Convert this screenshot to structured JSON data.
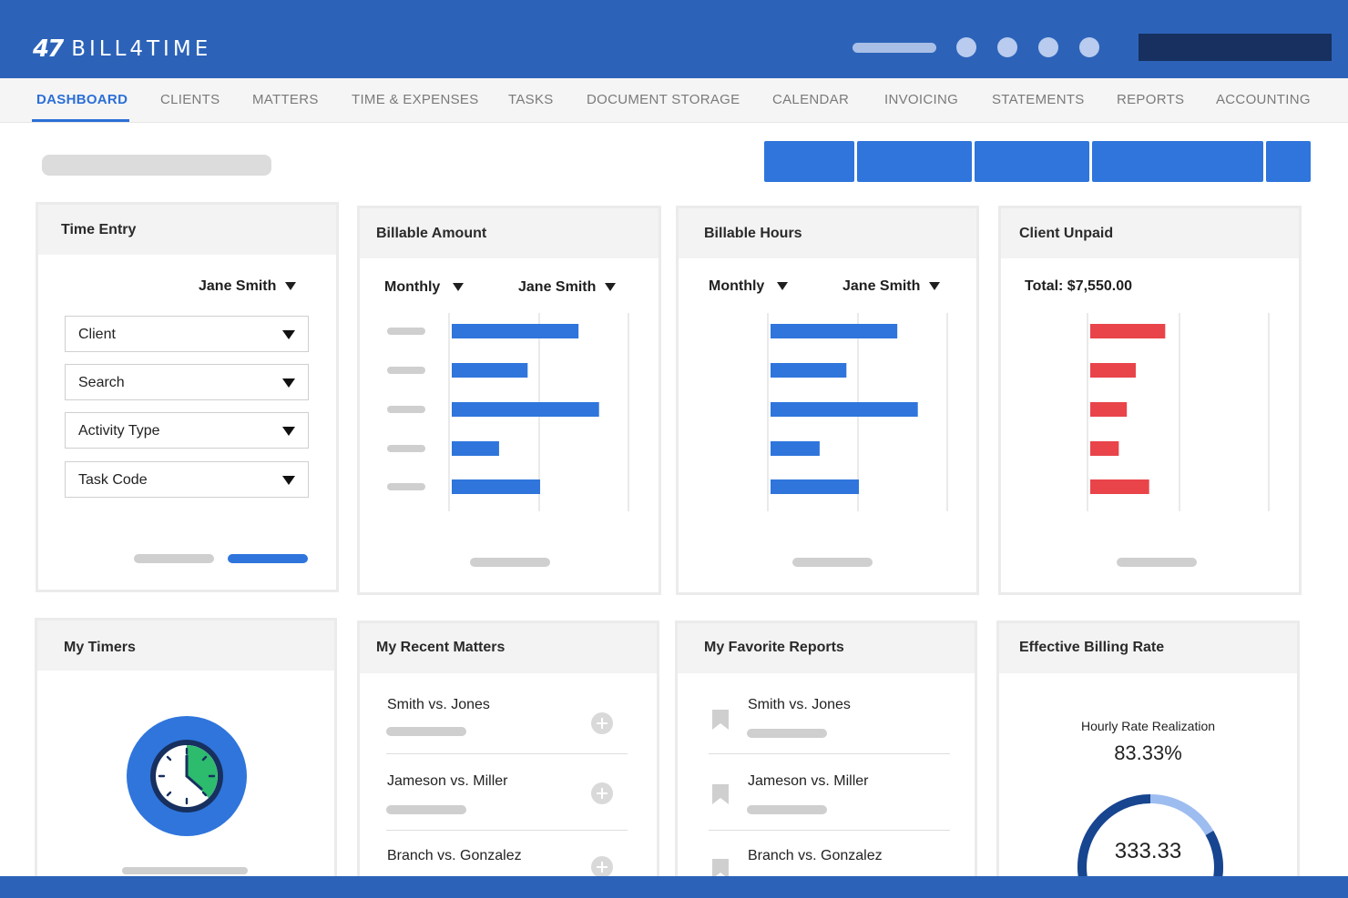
{
  "app": {
    "logo_mark": "47",
    "logo_text": "BILL4TIME"
  },
  "nav": {
    "items": [
      {
        "label": "DASHBOARD",
        "active": true
      },
      {
        "label": "CLIENTS"
      },
      {
        "label": "MATTERS"
      },
      {
        "label": "TIME & EXPENSES"
      },
      {
        "label": "TASKS"
      },
      {
        "label": "DOCUMENT STORAGE"
      },
      {
        "label": "CALENDAR"
      },
      {
        "label": "INVOICING"
      },
      {
        "label": "STATEMENTS"
      },
      {
        "label": "REPORTS"
      },
      {
        "label": "ACCOUNTING"
      }
    ]
  },
  "time_entry": {
    "title": "Time Entry",
    "user": "Jane Smith",
    "fields": [
      "Client",
      "Search",
      "Activity Type",
      "Task Code"
    ]
  },
  "billable_amount": {
    "title": "Billable Amount",
    "period": "Monthly",
    "user": "Jane Smith"
  },
  "billable_hours": {
    "title": "Billable Hours",
    "period": "Monthly",
    "user": "Jane Smith"
  },
  "client_unpaid": {
    "title": "Client Unpaid",
    "total": "Total: $7,550.00"
  },
  "my_timers": {
    "title": "My Timers"
  },
  "recent_matters": {
    "title": "My Recent Matters",
    "items": [
      "Smith vs. Jones",
      "Jameson vs. Miller",
      "Branch vs. Gonzalez"
    ]
  },
  "favorite_reports": {
    "title": "My Favorite Reports",
    "items": [
      "Smith vs. Jones",
      "Jameson vs. Miller",
      "Branch vs. Gonzalez"
    ]
  },
  "billing_rate": {
    "title": "Effective Billing Rate",
    "subtitle": "Hourly Rate Realization",
    "percent": "83.33%",
    "value": "333.33",
    "realization": 0.8333
  },
  "colors": {
    "brand": "#2c63b9",
    "accent": "#2f75dc",
    "unpaid": "#e8444a",
    "timer": "#2dbb6e"
  },
  "chart_data": [
    {
      "type": "bar",
      "title": "Billable Amount",
      "orientation": "horizontal",
      "categories": [
        "",
        "",
        "",
        "",
        ""
      ],
      "values": [
        1.42,
        0.85,
        1.65,
        0.53,
        0.99
      ],
      "xlim": [
        0,
        2
      ]
    },
    {
      "type": "bar",
      "title": "Billable Hours",
      "orientation": "horizontal",
      "categories": [
        "",
        "",
        "",
        "",
        ""
      ],
      "values": [
        1.42,
        0.85,
        1.65,
        0.55,
        0.99
      ],
      "xlim": [
        0,
        2
      ]
    },
    {
      "type": "bar",
      "title": "Client Unpaid",
      "orientation": "horizontal",
      "categories": [
        "",
        "",
        "",
        "",
        ""
      ],
      "values": [
        0.84,
        0.51,
        0.41,
        0.32,
        0.66
      ],
      "xlim": [
        0,
        2
      ]
    }
  ]
}
